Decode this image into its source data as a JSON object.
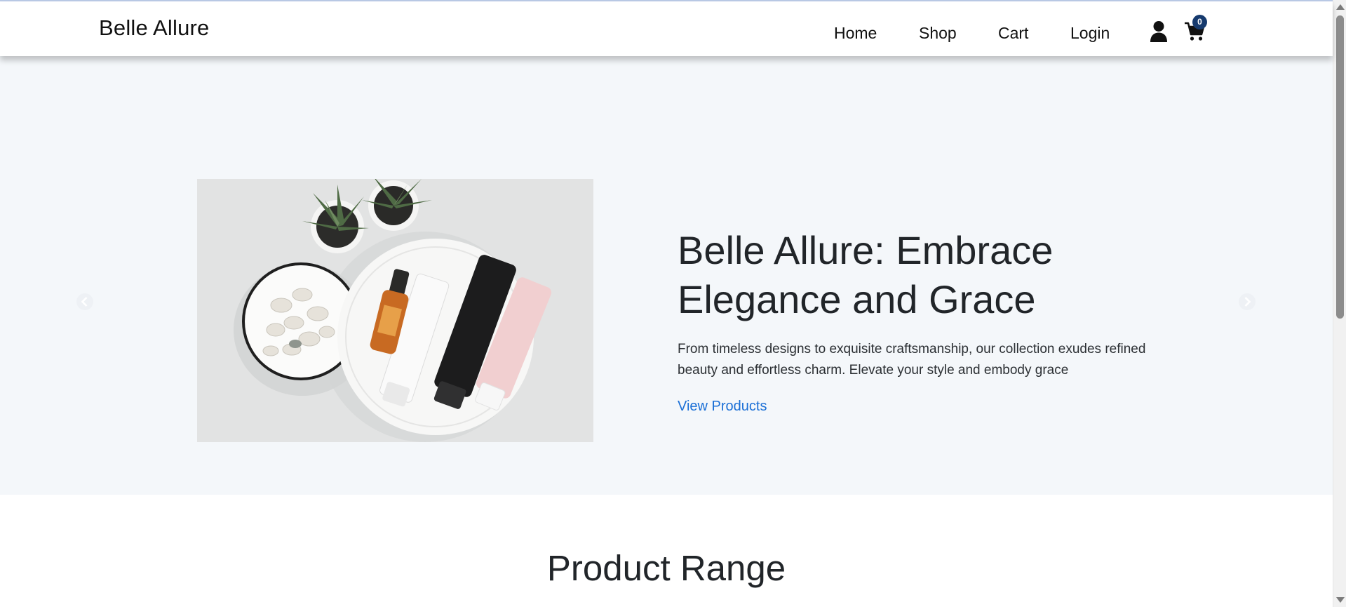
{
  "navbar": {
    "brand": "Belle Allure",
    "links": [
      {
        "label": "Home"
      },
      {
        "label": "Shop"
      },
      {
        "label": "Cart"
      },
      {
        "label": "Login"
      }
    ],
    "user_icon": "user-icon",
    "cart_icon": "shopping-cart-icon",
    "cart_count": "0",
    "badge_color": "#163a6e"
  },
  "hero": {
    "title": "Belle Allure: Embrace Elegance and Grace",
    "description": "From timeless designs to exquisite craftsmanship, our collection exudes refined beauty and effortless charm. Elevate your style and embody grace",
    "cta_label": "View Products",
    "background_color": "#f4f7fa",
    "link_color": "#1a6fd6",
    "prev_icon": "chevron-left-icon",
    "next_icon": "chevron-right-icon"
  },
  "products": {
    "section_title": "Product Range"
  }
}
